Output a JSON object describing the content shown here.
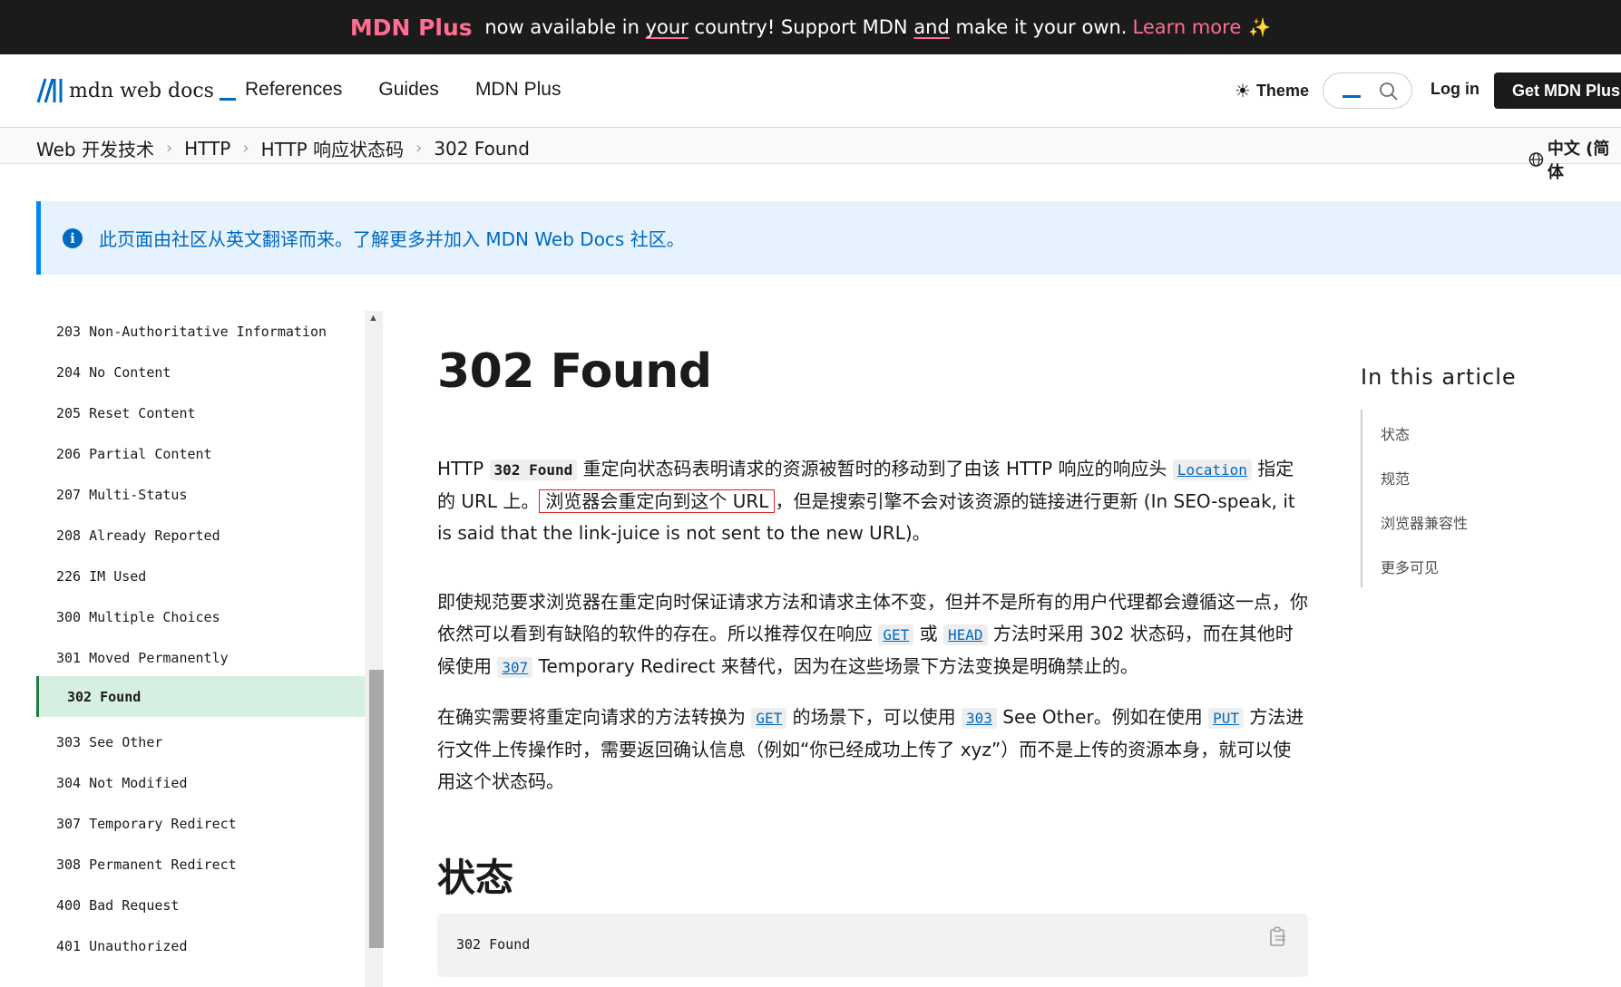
{
  "banner": {
    "brand": "MDN Plus",
    "t1": " now available in ",
    "your": "your",
    "t2": " country! Support MDN ",
    "and": "and",
    "t3": " make it your own.",
    "learn_more": "Learn more",
    "sparkle": "✨"
  },
  "header": {
    "logo_text": "mdn web docs",
    "nav": [
      "References",
      "Guides",
      "MDN Plus"
    ],
    "theme_label": "Theme",
    "login_label": "Log in",
    "get_plus_label": "Get MDN Plus"
  },
  "breadcrumbs": [
    "Web 开发技术",
    "HTTP",
    "HTTP 响应状态码",
    "302 Found"
  ],
  "language": "中文 (简体",
  "notice": {
    "icon": "info-icon",
    "text": "此页面由社区从英文翻译而来。了解更多并加入 MDN Web Docs 社区。"
  },
  "sidebar": {
    "items": [
      "203 Non-Authoritative Information",
      "204 No Content",
      "205 Reset Content",
      "206 Partial Content",
      "207 Multi-Status",
      "208 Already Reported",
      "226 IM Used",
      "300 Multiple Choices",
      "301 Moved Permanently",
      "302 Found",
      "303 See Other",
      "304 Not Modified",
      "307 Temporary Redirect",
      "308 Permanent Redirect",
      "400 Bad Request",
      "401 Unauthorized"
    ],
    "active_index": 9
  },
  "article": {
    "title": "302 Found",
    "p1": {
      "a": "HTTP ",
      "code": "302 Found",
      "b": " 重定向状态码表明请求的资源被暂时的移动到了由该 HTTP 响应的响应头 ",
      "link": "Location",
      "c": " 指定的 URL 上。",
      "boxed": "浏览器会重定向到这个 URL",
      "d": "，但是搜索引擎不会对该资源的链接进行更新 (In SEO-speak, it is said that the link-juice is not sent to the new URL)。"
    },
    "p2": {
      "a": "即使规范要求浏览器在重定向时保证请求方法和请求主体不变，但并不是所有的用户代理都会遵循这一点，你依然可以看到有缺陷的软件的存在。所以推荐仅在响应 ",
      "get": "GET",
      "b": " 或 ",
      "head": "HEAD",
      "c": " 方法时采用 302 状态码，而在其他时候使用 ",
      "r307": "307",
      "d": " Temporary Redirect 来替代，因为在这些场景下方法变换是明确禁止的。"
    },
    "p3": {
      "a": "在确实需要将重定向请求的方法转换为 ",
      "get": "GET",
      "b": " 的场景下，可以使用 ",
      "r303": "303",
      "c": " See Other。例如在使用 ",
      "put": "PUT",
      "d": " 方法进行文件上传操作时，需要返回确认信息（例如“你已经成功上传了 xyz”）而不是上传的资源本身，就可以使用这个状态码。"
    },
    "h2_status": "状态",
    "code_block": "302 Found"
  },
  "toc": {
    "title": "In this article",
    "items": [
      "状态",
      "规范",
      "浏览器兼容性",
      "更多可见"
    ]
  }
}
